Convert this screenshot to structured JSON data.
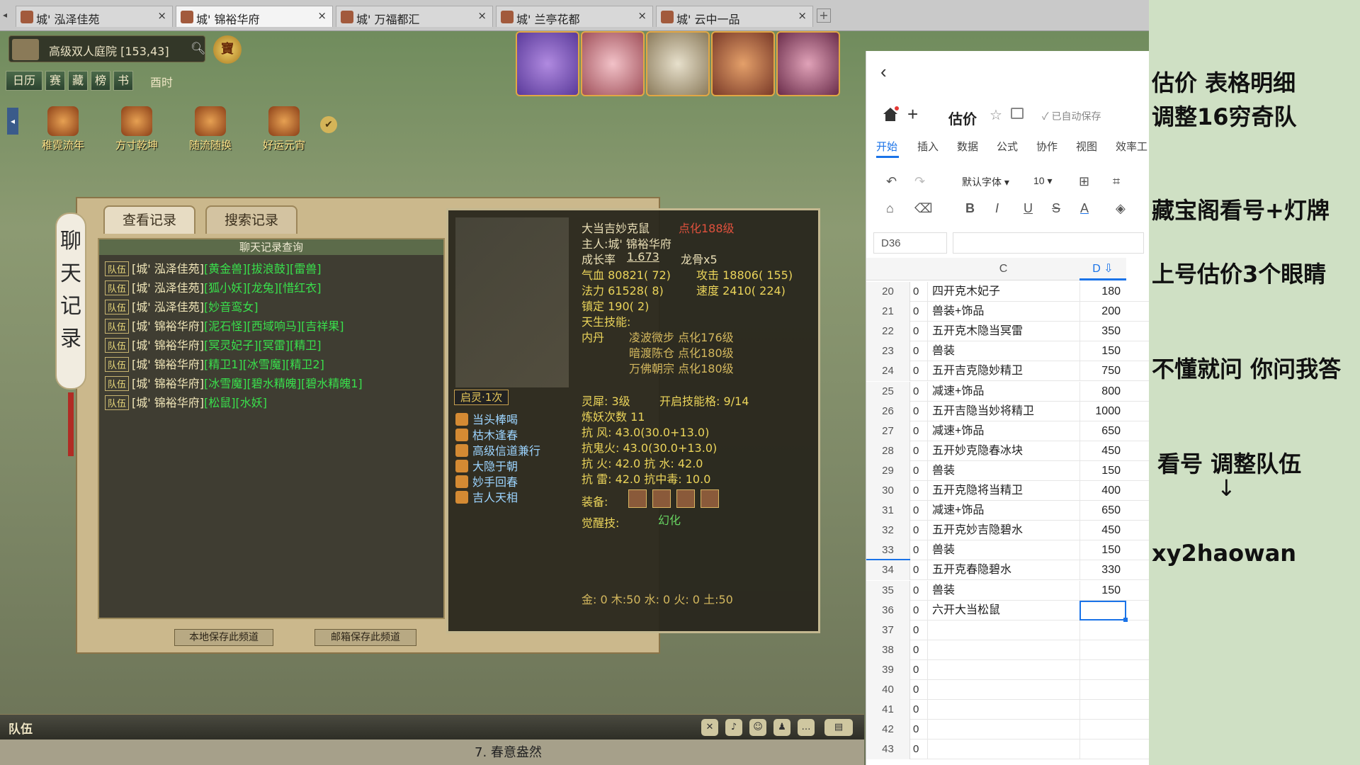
{
  "browser": {
    "tabs": [
      {
        "label": "城' 泓泽佳苑"
      },
      {
        "label": "城' 锦裕华府"
      },
      {
        "label": "城' 万福都汇"
      },
      {
        "label": "城' 兰亭花都"
      },
      {
        "label": "城' 云中一品"
      }
    ],
    "close_glyph": "×",
    "new_tab_glyph": "+"
  },
  "game": {
    "location": "高级双人庭院 [153,43]",
    "treasure_label": "寶",
    "menu": [
      "日历",
      "赛",
      "藏",
      "榜",
      "书"
    ],
    "time": "酉时",
    "activities": [
      "稚霓流年",
      "方寸乾坤",
      "随流随换",
      "好运元宵"
    ],
    "chat_panel": {
      "vertical_title": "聊天记录",
      "tabs": [
        "查看记录",
        "搜索记录"
      ],
      "header": "聊天记录查询",
      "team_tag": "队伍",
      "lines": [
        {
          "name": "[城' 泓泽佳苑]",
          "pets": "[黄金兽][拔浪鼓][雷兽]"
        },
        {
          "name": "[城' 泓泽佳苑]",
          "pets": "[狐小妖][龙兔][惜红衣]"
        },
        {
          "name": "[城' 泓泽佳苑]",
          "pets": "[妙音鸾女]"
        },
        {
          "name": "[城' 锦裕华府]",
          "pets": "[泥石怪][西域响马][吉祥果]"
        },
        {
          "name": "[城' 锦裕华府]",
          "pets": "[冥灵妃子][冥雷][精卫]"
        },
        {
          "name": "[城' 锦裕华府]",
          "pets": "[精卫1][冰雪魔][精卫2]"
        },
        {
          "name": "[城' 锦裕华府]",
          "pets": "[冰雪魔][碧水精魄][碧水精魄1]"
        },
        {
          "name": "[城' 锦裕华府]",
          "pets": "[松鼠][水妖]"
        }
      ],
      "buttons": [
        "本地保存此频道",
        "邮箱保存此频道"
      ]
    },
    "pet_detail": {
      "name": "大当吉妙克鼠",
      "dianhua": "点化188级",
      "owner": "主人:城' 锦裕华府",
      "growth_label": "成长率",
      "growth": "1.673",
      "bone": "龙骨x5",
      "hp": "气血 80821( 72)",
      "attack": "攻击 18806( 155)",
      "mp": "法力 61528( 8)",
      "speed": "速度 2410( 224)",
      "focus": "镇定 190( 2)",
      "innate_label": "天生技能:",
      "neidan_label": "内丹",
      "neidan": [
        "凌波微步 点化176级",
        "暗渡陈仓 点化180级",
        "万佛朝宗 点化180级"
      ],
      "qiling": "启灵·1次",
      "skills": [
        "当头棒喝",
        "枯木逢春",
        "高级信道兼行",
        "大隐于朝",
        "妙手回春",
        "吉人天相"
      ],
      "lingxi": "灵犀: 3级",
      "open_skill": "开启技能格: 9/14",
      "lianyao": "炼妖次数 11",
      "resist": [
        "抗 风: 43.0(30.0+13.0)",
        "抗鬼火: 43.0(30.0+13.0)",
        "抗 火: 42.0   抗 水: 42.0",
        "抗 雷: 42.0   抗中毒: 10.0"
      ],
      "equip_label": "装备:",
      "awaken_label": "觉醒技:",
      "awaken": "幻化",
      "elements": "金: 0 木:50 水: 0 火: 0 土:50"
    },
    "bottom": {
      "team_label": "队伍",
      "status_item": "7.  春意盎然"
    }
  },
  "sheet": {
    "back_glyph": "‹",
    "plus_glyph": "+",
    "star_glyph": "☆",
    "title": "估价",
    "autosave": "已自动保存",
    "menu": [
      "开始",
      "插入",
      "数据",
      "公式",
      "协作",
      "视图",
      "效率工"
    ],
    "tools": {
      "undo": "↶",
      "redo": "↷",
      "format_painter": "⌂",
      "eraser": "⌫",
      "bold": "B",
      "italic": "I",
      "underline": "U",
      "strike": "S",
      "fontcolor": "A",
      "fill": "◈",
      "border": "⊞",
      "crop": "⌗"
    },
    "font": "默认字体 ▾",
    "font_size": "10 ▾",
    "cell_ref": "D36",
    "columns": [
      "C",
      "D"
    ],
    "rows": [
      {
        "n": "20",
        "b": "0",
        "c": "四开克木妃子",
        "d": "180"
      },
      {
        "n": "21",
        "b": "0",
        "c": "兽装+饰品",
        "d": "200"
      },
      {
        "n": "22",
        "b": "0",
        "c": "五开克木隐当冥雷",
        "d": "350"
      },
      {
        "n": "23",
        "b": "0",
        "c": "兽装",
        "d": "150"
      },
      {
        "n": "24",
        "b": "0",
        "c": "五开吉克隐妙精卫",
        "d": "750"
      },
      {
        "n": "25",
        "b": "0",
        "c": "减速+饰品",
        "d": "800"
      },
      {
        "n": "26",
        "b": "0",
        "c": "五开吉隐当妙将精卫",
        "d": "1000"
      },
      {
        "n": "27",
        "b": "0",
        "c": "减速+饰品",
        "d": "650"
      },
      {
        "n": "28",
        "b": "0",
        "c": "五开妙克隐春冰块",
        "d": "450"
      },
      {
        "n": "29",
        "b": "0",
        "c": "兽装",
        "d": "150"
      },
      {
        "n": "30",
        "b": "0",
        "c": "五开克隐将当精卫",
        "d": "400"
      },
      {
        "n": "31",
        "b": "0",
        "c": "减速+饰品",
        "d": "650"
      },
      {
        "n": "32",
        "b": "0",
        "c": "五开克妙吉隐碧水",
        "d": "450"
      },
      {
        "n": "33",
        "b": "0",
        "c": "兽装",
        "d": "150"
      },
      {
        "n": "34",
        "b": "0",
        "c": "五开克春隐碧水",
        "d": "330"
      },
      {
        "n": "35",
        "b": "0",
        "c": "兽装",
        "d": "150"
      },
      {
        "n": "36",
        "b": "0",
        "c": "六开大当松鼠",
        "d": ""
      },
      {
        "n": "37",
        "b": "0",
        "c": "",
        "d": ""
      },
      {
        "n": "38",
        "b": "0",
        "c": "",
        "d": ""
      },
      {
        "n": "39",
        "b": "0",
        "c": "",
        "d": ""
      },
      {
        "n": "40",
        "b": "0",
        "c": "",
        "d": ""
      },
      {
        "n": "41",
        "b": "0",
        "c": "",
        "d": ""
      },
      {
        "n": "42",
        "b": "0",
        "c": "",
        "d": ""
      },
      {
        "n": "43",
        "b": "0",
        "c": "",
        "d": ""
      }
    ]
  },
  "notes": {
    "line1": "估价  表格明细",
    "line2": "调整16穷奇队",
    "line3": "藏宝阁看号+灯牌",
    "line4": "上号估价3个眼睛",
    "line5": "不懂就问 你问我答",
    "line6": "看号 调整队伍",
    "arrow": "↓",
    "line7": "xy2haowan"
  }
}
